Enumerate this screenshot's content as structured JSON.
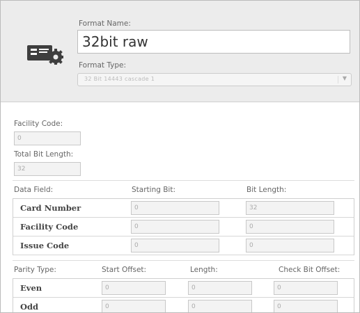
{
  "format": {
    "name_label": "Format Name:",
    "name_value": "32bit raw",
    "type_label": "Format Type:",
    "type_value": "32 Bit 14443 cascade 1"
  },
  "facility": {
    "label": "Facility Code:",
    "value": "0"
  },
  "total_bits": {
    "label": "Total Bit Length:",
    "value": "32"
  },
  "data_table": {
    "headers": [
      "Data Field:",
      "Starting Bit:",
      "Bit Length:"
    ],
    "rows": [
      {
        "name": "Card Number",
        "start": "0",
        "length": "32"
      },
      {
        "name": "Facility Code",
        "start": "0",
        "length": "0"
      },
      {
        "name": "Issue Code",
        "start": "0",
        "length": "0"
      }
    ]
  },
  "parity_table": {
    "headers": [
      "Parity Type:",
      "Start Offset:",
      "Length:",
      "Check Bit Offset:"
    ],
    "rows": [
      {
        "name": "Even",
        "start": "0",
        "length": "0",
        "check": "0"
      },
      {
        "name": "Odd",
        "start": "0",
        "length": "0",
        "check": "0"
      }
    ]
  },
  "icons": {
    "format": "card-gear-icon",
    "dropdown": "chevron-down-icon"
  },
  "colors": {
    "header_bg": "#ececec",
    "field_bg": "#f3f3f3",
    "border": "#c8c8c8",
    "text": "#555555"
  }
}
